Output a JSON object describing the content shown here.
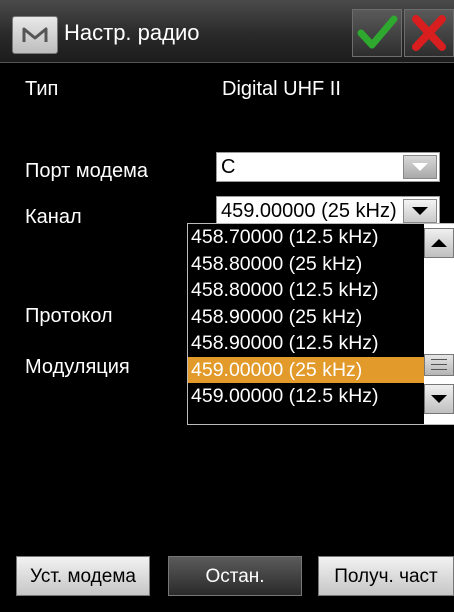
{
  "window": {
    "title": "Настр. радио"
  },
  "fields": {
    "type_label": "Тип",
    "type_value": "Digital UHF II",
    "port_label": "Порт модема",
    "port_value": "C",
    "channel_label": "Канал",
    "channel_value": "459.00000 (25 kHz)",
    "protocol_label": "Протокол",
    "modulation_label": "Модуляция"
  },
  "channel_dropdown": {
    "options": [
      "458.70000 (12.5 kHz)",
      "458.80000 (25 kHz)",
      "458.80000 (12.5 kHz)",
      "458.90000 (25 kHz)",
      "458.90000 (12.5 kHz)",
      "459.00000 (25 kHz)",
      "459.00000 (12.5 kHz)"
    ],
    "selected_index": 5,
    "highlight_color": "#e29a2a"
  },
  "buttons": {
    "set_modem": "Уст. модема",
    "stop": "Остан.",
    "get_freq": "Получ. част"
  },
  "colors": {
    "ok_green": "#2fa82f",
    "cancel_red": "#d81e1e"
  }
}
